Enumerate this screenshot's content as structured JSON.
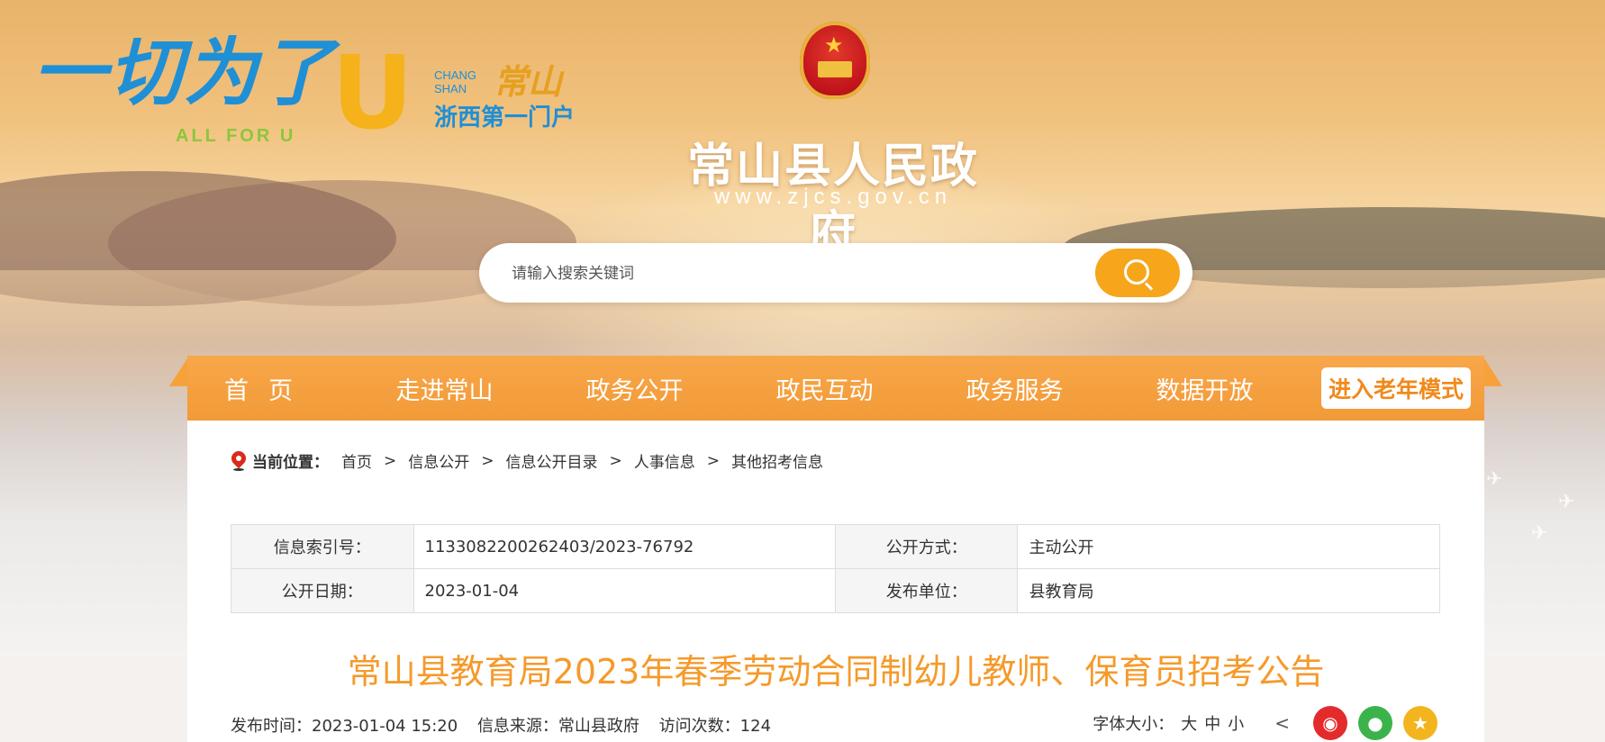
{
  "branding": {
    "slogan": "一切为了",
    "slogan_u": "U",
    "slogan_en": "ALL FOR U",
    "city_en_1": "CHANG",
    "city_en_2": "SHAN",
    "city_zh": "常山",
    "city_tagline": "浙西第一门户"
  },
  "header": {
    "site_title": "常山县人民政府",
    "site_url": "www.zjcs.gov.cn"
  },
  "search": {
    "placeholder": "请输入搜索关键词"
  },
  "nav": {
    "items": [
      "首页",
      "走进常山",
      "政务公开",
      "政民互动",
      "政务服务",
      "数据开放"
    ],
    "elder_mode": "进入老年模式"
  },
  "breadcrumb": {
    "label": "当前位置：",
    "items": [
      "首页",
      "信息公开",
      "信息公开目录",
      "人事信息",
      "其他招考信息"
    ],
    "separator": ">"
  },
  "meta": {
    "index_no_label": "信息索引号：",
    "index_no": "1133082200262403/2023-76792",
    "method_label": "公开方式：",
    "method": "主动公开",
    "date_label": "公开日期：",
    "date": "2023-01-04",
    "unit_label": "发布单位：",
    "unit": "县教育局"
  },
  "article": {
    "title": "常山县教育局2023年春季劳动合同制幼儿教师、保育员招考公告",
    "publish_time": "发布时间：2023-01-04 15:20",
    "source": "信息来源：常山县政府",
    "visits": "访问次数：124"
  },
  "tools": {
    "font_size_label": "字体大小：",
    "sizes": [
      "大",
      "中",
      "小"
    ]
  },
  "colors": {
    "nav_orange": "#f29a37",
    "title_orange": "#f59a2b",
    "search_btn": "#f7a51b"
  }
}
